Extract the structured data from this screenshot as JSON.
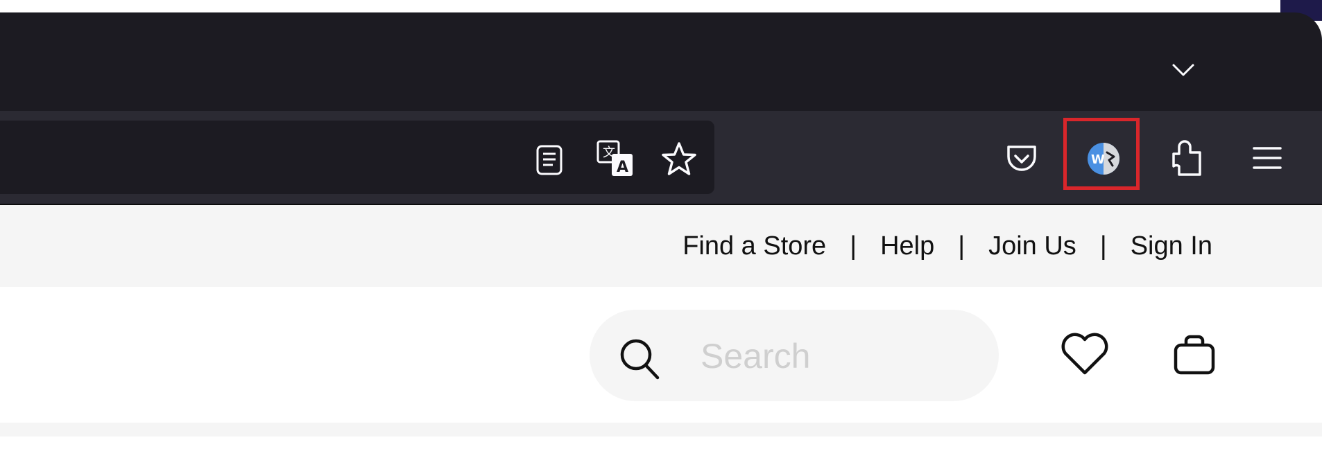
{
  "browser": {
    "tab_list_icon": "chevron-down-icon",
    "toolbar_icons": {
      "reader_view": "reader-view-icon",
      "translate": "translate-icon",
      "bookmark": "star-icon",
      "pocket": "pocket-icon",
      "extension_highlighted": "wordtune-extension-icon",
      "extensions": "puzzle-icon",
      "menu": "hamburger-menu-icon"
    },
    "highlight_color": "#d9262b"
  },
  "site": {
    "util_nav": {
      "find_store": "Find a Store",
      "help": "Help",
      "join_us": "Join Us",
      "sign_in": "Sign In",
      "separator": "|"
    },
    "search": {
      "placeholder": "Search"
    },
    "icons": {
      "favorites": "heart-icon",
      "bag": "bag-icon"
    }
  }
}
